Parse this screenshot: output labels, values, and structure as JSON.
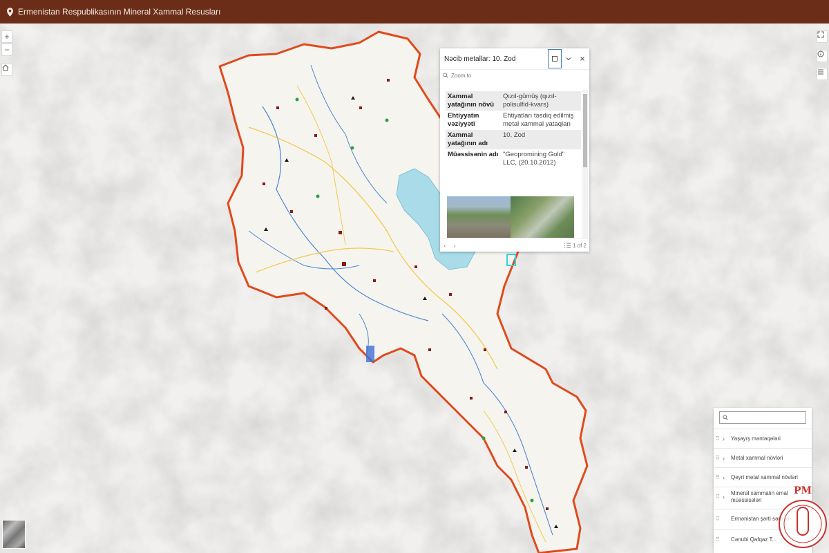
{
  "header": {
    "title": "Ermenistan Respublikasının Mineral Xammal Resusları"
  },
  "map_controls": {
    "zoom_in": "+",
    "zoom_out": "−",
    "home_icon": "home-icon",
    "right_icons": [
      "expand-icon",
      "info-icon",
      "layer-list-icon"
    ]
  },
  "popup": {
    "title": "Nəcib metallar: 10. Zod",
    "zoom_to": "Zoom to",
    "fields": [
      {
        "label": "Xammal yatağının növü",
        "value": "Qızıl-gümüş (qızıl-polisulfid-kvars)"
      },
      {
        "label": "Ehtiyyatın vəziyyəti",
        "value": "Ehtiyatları təsdiq edilmiş metal xammal yataqları"
      },
      {
        "label": "Xammal yatağının adı",
        "value": "10. Zod"
      },
      {
        "label": "Müəssisənin adı",
        "value": "\"Geopromining Gold\" LLC, (20.10.2012)"
      }
    ],
    "pager": "1 of 2"
  },
  "layers": {
    "items": [
      {
        "label": "Yaşayış məntəqələri"
      },
      {
        "label": "Metal xammal növləri"
      },
      {
        "label": "Qeyri metal xammal növləri"
      },
      {
        "label": "Mineral xammalın emal müəssisələri"
      },
      {
        "label": "Ermənistan şərti sərhəd"
      },
      {
        "label": "Cənubi Qafqaz T..."
      }
    ]
  },
  "logo": {
    "text": "PM"
  },
  "colors": {
    "header_bg": "#6b2d17",
    "border": "#e04a1c",
    "lake": "#a9dbe8"
  }
}
